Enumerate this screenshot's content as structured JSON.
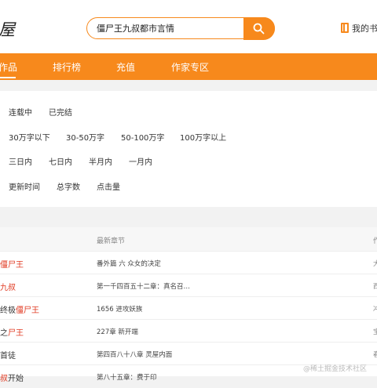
{
  "header": {
    "logo_text": "屋",
    "search_value": "僵尸王九叔都市言情",
    "mybook_label": "我的书"
  },
  "nav": {
    "items": [
      "作品",
      "排行榜",
      "充值",
      "作家专区"
    ]
  },
  "filters": {
    "status": [
      "连载中",
      "已完结"
    ],
    "word_count": [
      "30万字以下",
      "30-50万字",
      "50-100万字",
      "100万字以上"
    ],
    "update_range": [
      "三日内",
      "七日内",
      "半月内",
      "一月内"
    ],
    "sort": [
      "更新时间",
      "总字数",
      "点击量"
    ]
  },
  "table": {
    "columns": [
      "最新章节",
      "作"
    ],
    "rows": [
      {
        "prefix": "",
        "highlight": "僵尸王",
        "suffix": "",
        "chapter": "番外篇 六 众女的决定",
        "author": "大"
      },
      {
        "prefix": "",
        "highlight": "九叔",
        "suffix": "",
        "chapter": "第一千四百五十二章：真名召…",
        "author": "西"
      },
      {
        "prefix": "终极",
        "highlight": "僵尸王",
        "suffix": "",
        "chapter": "1656 进攻妖族",
        "author": "冲"
      },
      {
        "prefix": "之",
        "highlight": "尸王",
        "suffix": "",
        "chapter": "227章 新开端",
        "author": "宝"
      },
      {
        "prefix": "首徒",
        "highlight": "",
        "suffix": "",
        "chapter": "第四百八十八章 灵屋内面",
        "author": "春"
      },
      {
        "prefix": "",
        "highlight": "叔",
        "suffix": "开始",
        "chapter": "第八十五章：费于印",
        "author": ""
      }
    ]
  },
  "watermark": "@稀土掘金技术社区",
  "colors": {
    "accent": "#f7891c",
    "highlight": "#e03a22"
  }
}
